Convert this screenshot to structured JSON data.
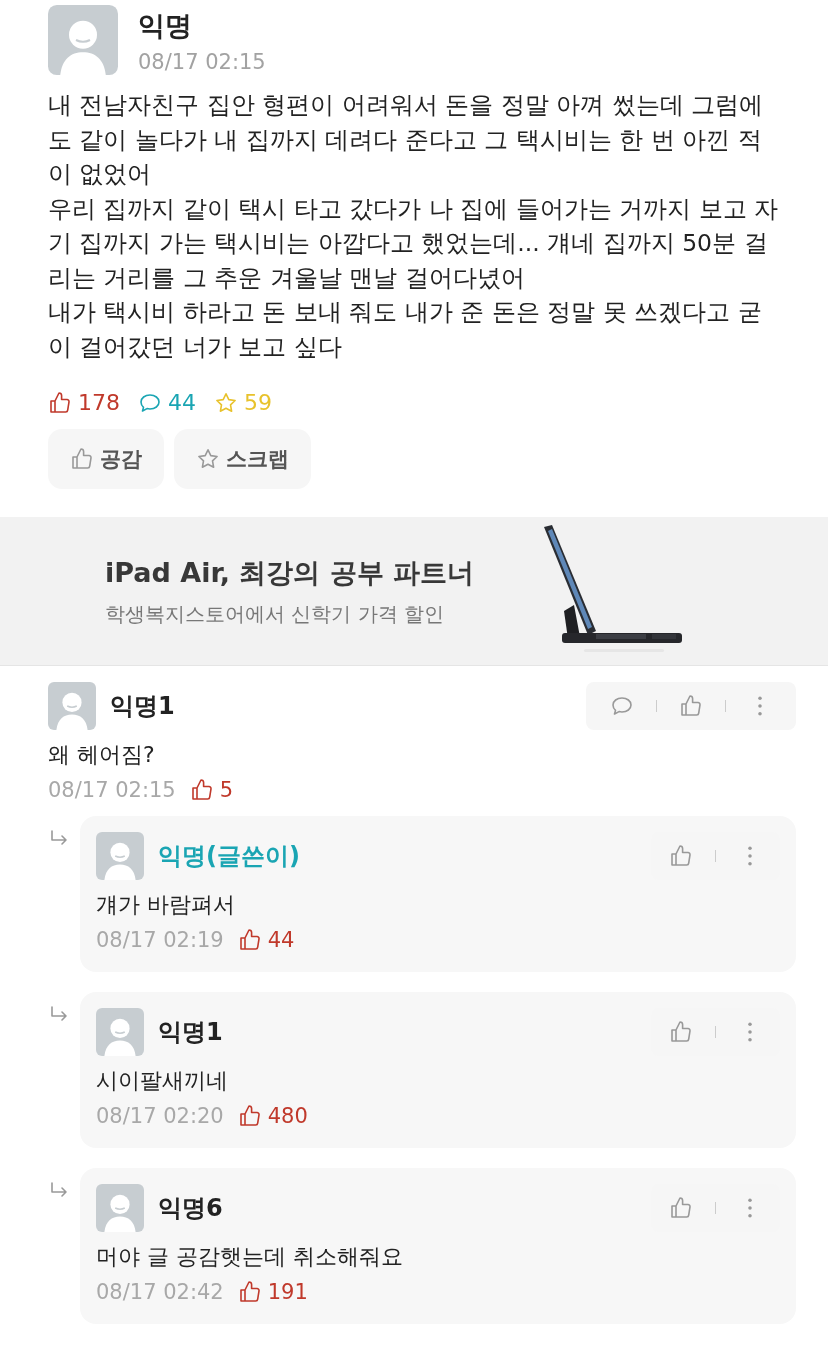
{
  "post": {
    "author": "익명",
    "time": "08/17 02:15",
    "body": [
      "내 전남자친구 집안 형편이 어려워서 돈을 정말 아껴 썼는데 그럼에도 같이 놀다가 내 집까지 데려다 준다고 그 택시비는 한 번 아낀 적이 없었어",
      "우리 집까지 같이 택시 타고 갔다가 나 집에 들어가는 거까지 보고 자기 집까지 가는 택시비는 아깝다고 했었는데... 걔네 집까지 50분 걸리는 거리를 그 추운 겨울날 맨날 걸어다녔어",
      "내가 택시비 하라고 돈 보내 줘도 내가 준 돈은 정말  못 쓰겠다고 굳이 걸어갔던 너가 보고 싶다"
    ],
    "stats": [
      {
        "kind": "like",
        "value": "178"
      },
      {
        "kind": "comment",
        "value": "44"
      },
      {
        "kind": "scrap",
        "value": "59"
      }
    ],
    "buttons": [
      {
        "kind": "like",
        "label": "공감"
      },
      {
        "kind": "scrap",
        "label": "스크랩"
      }
    ]
  },
  "ad": {
    "title": "iPad Air, 최강의 공부 파트너",
    "subtitle": "학생복지스토어에서 신학기 가격 할인"
  },
  "comments": [
    {
      "author": "익명1",
      "is_writer": false,
      "text": "왜 헤어짐?",
      "time": "08/17 02:15",
      "likes": "5",
      "replies": [
        {
          "author": "익명(글쓴이)",
          "is_writer": true,
          "text": "걔가 바람펴서",
          "time": "08/17 02:19",
          "likes": "44"
        },
        {
          "author": "익명1",
          "is_writer": false,
          "text": "시이팔새끼네",
          "time": "08/17 02:20",
          "likes": "480"
        },
        {
          "author": "익명6",
          "is_writer": false,
          "text": "머야 글 공감햇는데 취소해줘요",
          "time": "08/17 02:42",
          "likes": "191"
        }
      ]
    }
  ]
}
